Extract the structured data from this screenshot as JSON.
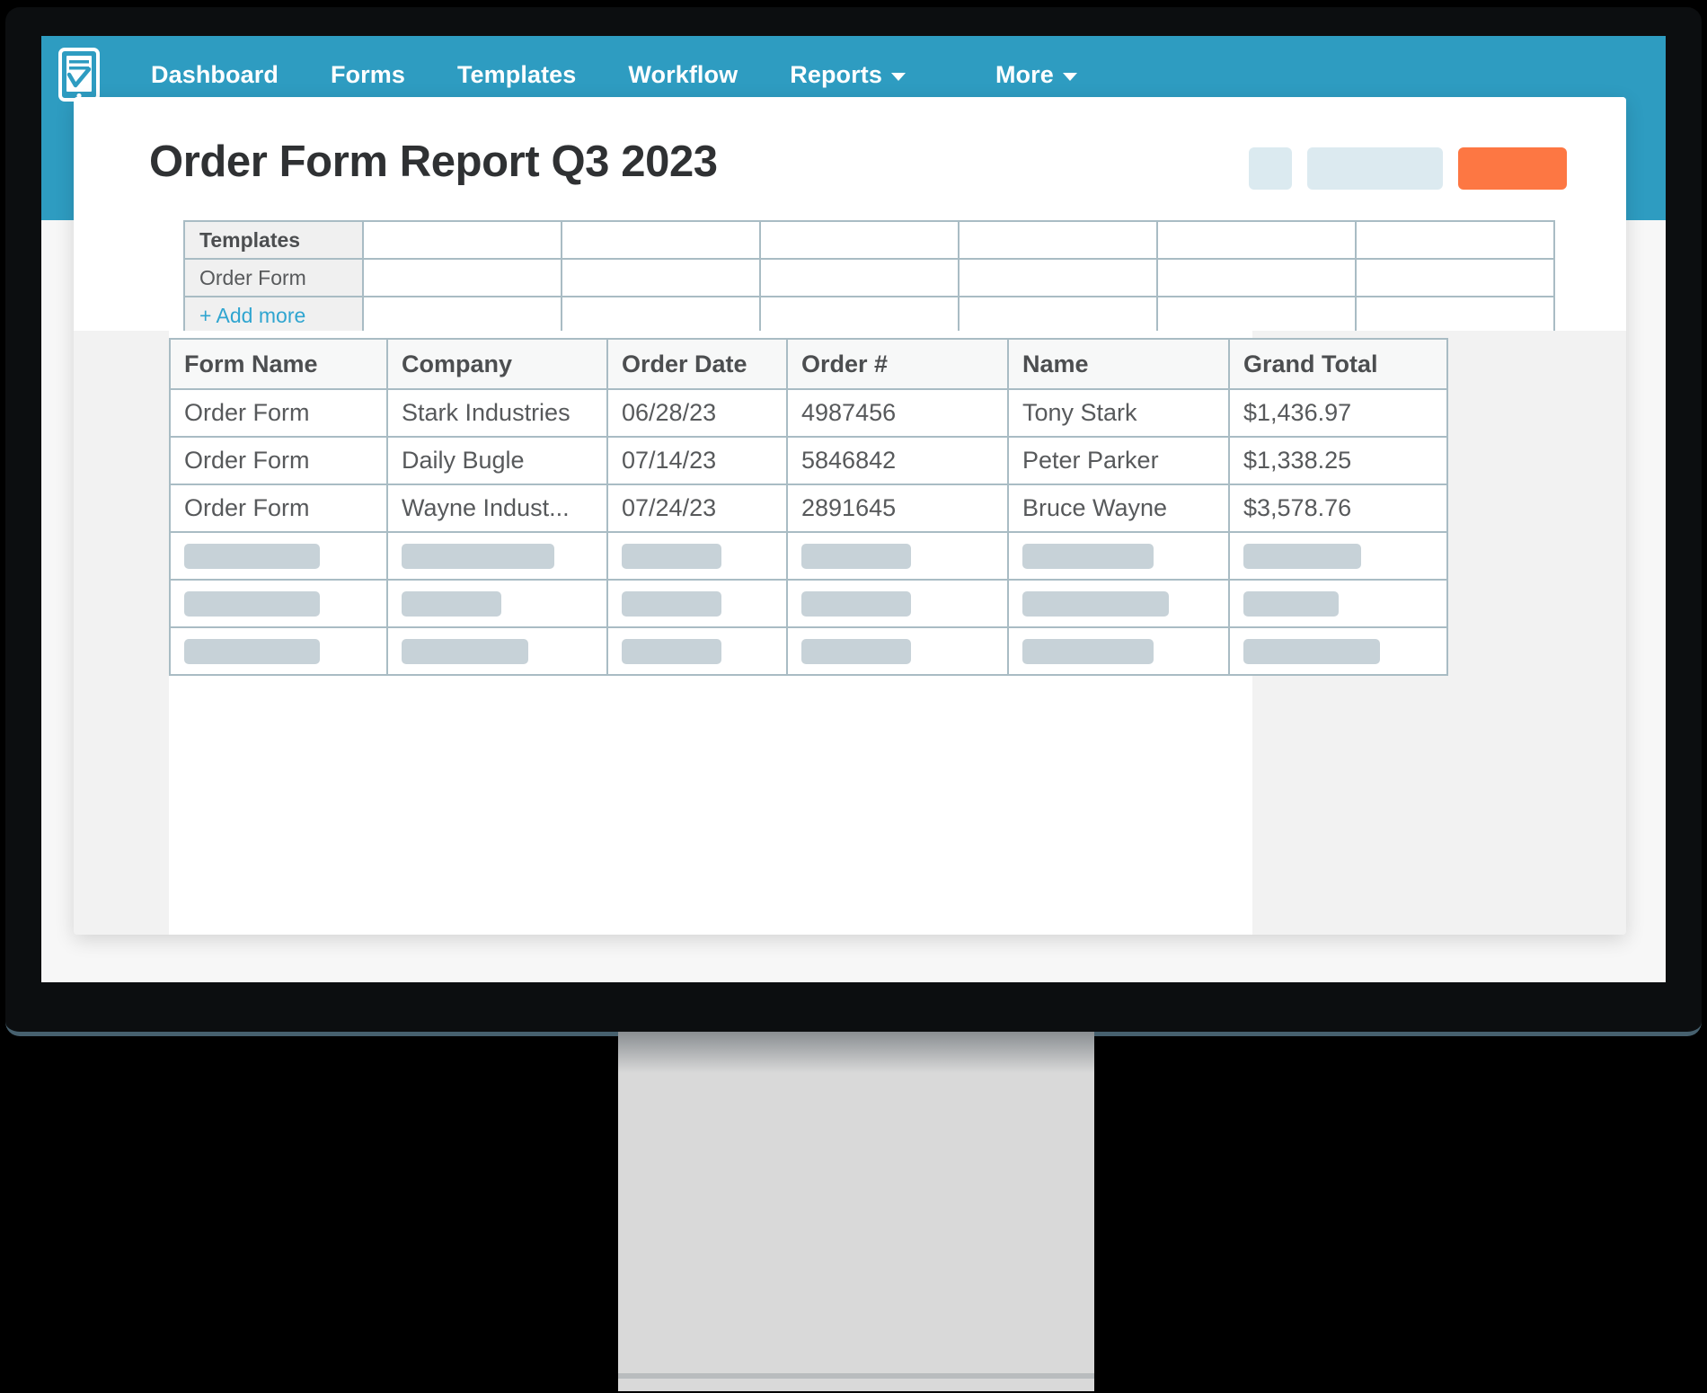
{
  "brand": {
    "logo_icon": "clipboard-check-icon",
    "topbar_color": "#2e9cc1",
    "accent_color": "#fd7743",
    "link_color": "#2fa5d0"
  },
  "nav": {
    "items": [
      {
        "label": "Dashboard",
        "has_caret": false
      },
      {
        "label": "Forms",
        "has_caret": false
      },
      {
        "label": "Templates",
        "has_caret": false
      },
      {
        "label": "Workflow",
        "has_caret": false
      },
      {
        "label": "Reports",
        "has_caret": true
      },
      {
        "label": "More",
        "has_caret": true
      }
    ]
  },
  "page": {
    "title": "Order Form Report Q3 2023"
  },
  "header_actions": [
    {
      "name": "icon-button-placeholder",
      "style": "small",
      "label": ""
    },
    {
      "name": "secondary-button-placeholder",
      "style": "medium",
      "label": ""
    },
    {
      "name": "primary-button-placeholder",
      "style": "accent",
      "label": ""
    }
  ],
  "templates_panel": {
    "rows": [
      {
        "label": "Templates",
        "kind": "header",
        "cells": [
          "",
          "",
          "",
          "",
          "",
          ""
        ]
      },
      {
        "label": "Order Form",
        "kind": "item",
        "cells": [
          "",
          "",
          "",
          "",
          "",
          ""
        ]
      },
      {
        "label": "+ Add more",
        "kind": "action",
        "cells": [
          "",
          "",
          "",
          "",
          "",
          ""
        ]
      }
    ]
  },
  "report_table": {
    "columns": [
      "Form Name",
      "Company",
      "Order Date",
      "Order #",
      "Name",
      "Grand Total"
    ],
    "rows": [
      [
        "Order Form",
        "Stark Industries",
        "06/28/23",
        "4987456",
        "Tony Stark",
        "$1,436.97"
      ],
      [
        "Order Form",
        "Daily Bugle",
        "07/14/23",
        "5846842",
        "Peter Parker",
        "$1,338.25"
      ],
      [
        "Order Form",
        "Wayne Indust...",
        "07/24/23",
        "2891645",
        "Bruce Wayne",
        "$3,578.76"
      ]
    ],
    "placeholder_rows": [
      [
        72,
        80,
        66,
        57,
        68,
        62
      ],
      [
        72,
        52,
        66,
        57,
        76,
        50
      ],
      [
        72,
        66,
        66,
        57,
        68,
        72
      ]
    ]
  }
}
